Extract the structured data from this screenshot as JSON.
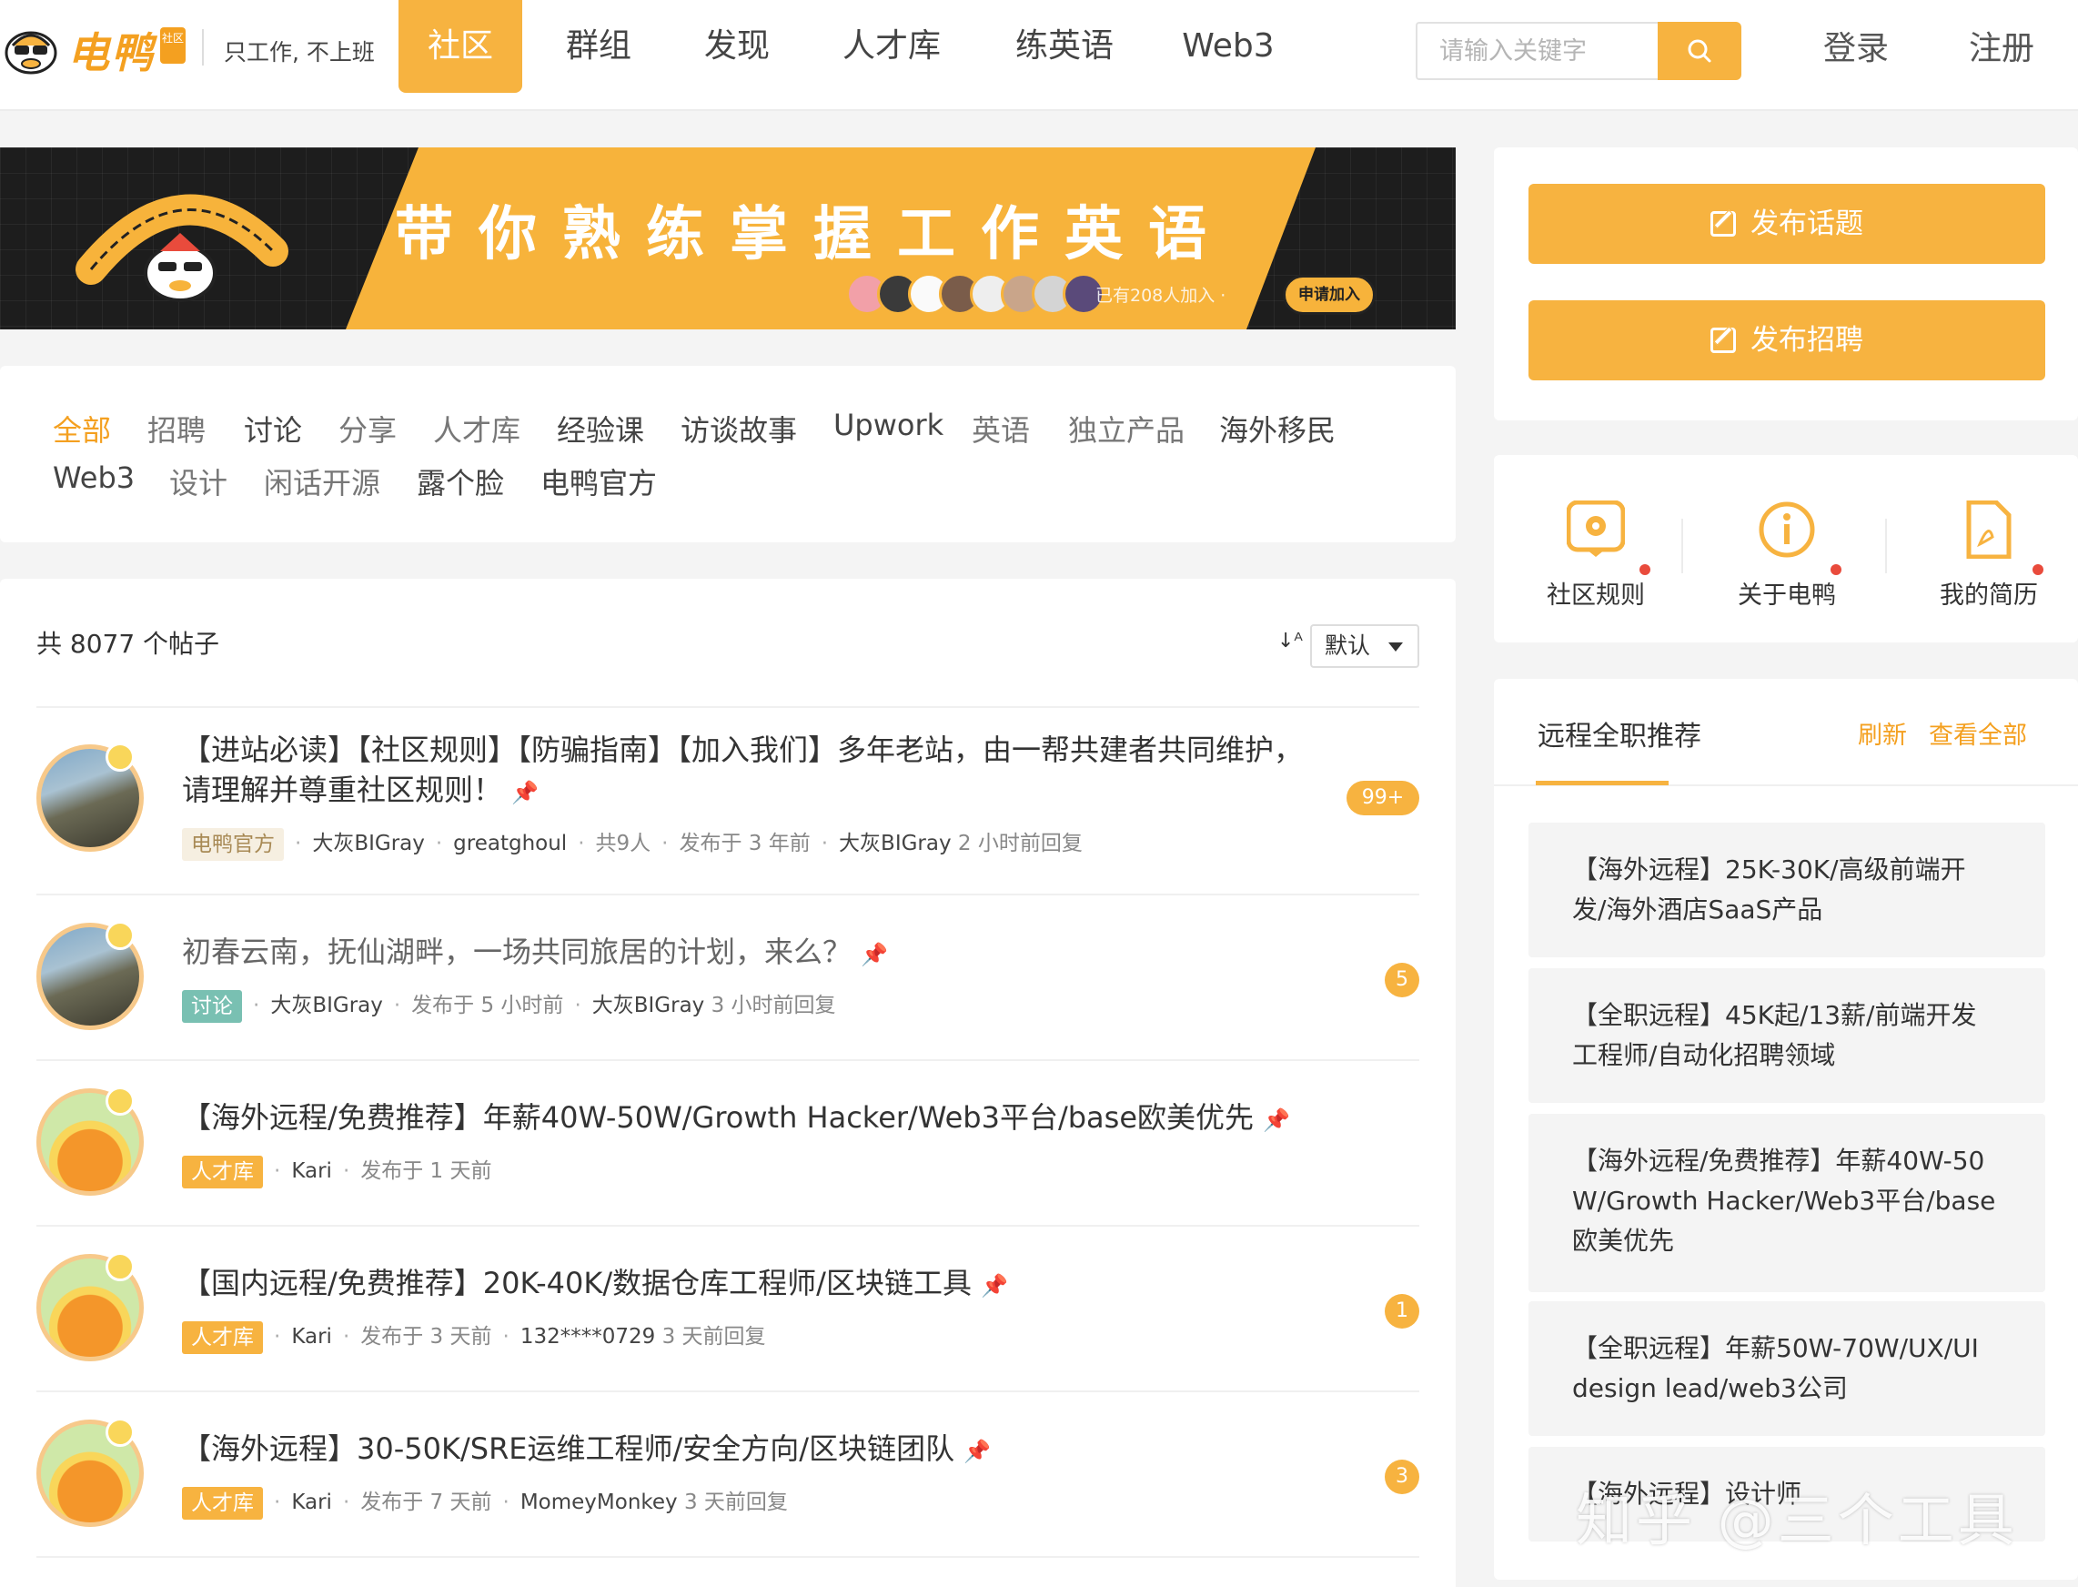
{
  "header": {
    "brand": "电鸭",
    "brand_tag": "社区",
    "slogan": "只工作, 不上班",
    "nav": [
      "社区",
      "群组",
      "发现",
      "人才库",
      "练英语",
      "Web3"
    ],
    "search_placeholder": "请输入关键字",
    "login": "登录",
    "register": "注册",
    "accent_color": "#f7b340"
  },
  "banner": {
    "title": "带你熟练掌握工作英语",
    "joined": "已有208人加入 ·",
    "apply": "申请加入"
  },
  "categories": {
    "row1": [
      "全部",
      "招聘",
      "讨论",
      "分享",
      "人才库",
      "经验课",
      "访谈故事",
      "Upwork",
      "英语",
      "独立产品",
      "海外移民"
    ],
    "row2": [
      "Web3",
      "设计",
      "闲话开源",
      "露个脸",
      "电鸭官方"
    ],
    "active": "全部"
  },
  "posts": {
    "count_text": "共 8077 个帖子",
    "sort_label": "默认",
    "items": [
      {
        "title_line1": "【进站必读】【社区规则】【防骗指南】【加入我们】多年老站，由一帮共建者共同维护，",
        "title_line2": "请理解并尊重社区规则！",
        "tag": "电鸭官方",
        "author": "大灰BIGray",
        "coauthor": "greatghoul",
        "people": "共9人",
        "posted": "发布于 3 年前",
        "replier": "大灰BIGray",
        "replied": "2 小时前回复",
        "count": "99+"
      },
      {
        "title_line1": "初春云南，抚仙湖畔，一场共同旅居的计划，来么？",
        "tag": "讨论",
        "author": "大灰BIGray",
        "posted": "发布于 5 小时前",
        "replier": "大灰BIGray",
        "replied": "3 小时前回复",
        "count": "5"
      },
      {
        "title_line1": "【海外远程/免费推荐】年薪40W-50W/Growth Hacker/Web3平台/base欧美优先",
        "tag": "人才库",
        "author": "Kari",
        "posted": "发布于 1 天前"
      },
      {
        "title_line1": "【国内远程/免费推荐】20K-40K/数据仓库工程师/区块链工具",
        "tag": "人才库",
        "author": "Kari",
        "posted": "发布于 3 天前",
        "replier": "132****0729",
        "replied": "3 天前回复",
        "count": "1"
      },
      {
        "title_line1": "【海外远程】30-50K/SRE运维工程师/安全方向/区块链团队",
        "tag": "人才库",
        "author": "Kari",
        "posted": "发布于 7 天前",
        "replier": "MomeyMonkey",
        "replied": "3 天前回复",
        "count": "3"
      }
    ]
  },
  "sidebar": {
    "publish_topic": "发布话题",
    "publish_job": "发布招聘",
    "quick_links": [
      "社区规则",
      "关于电鸭",
      "我的简历"
    ],
    "jobs_title": "远程全职推荐",
    "refresh": "刷新",
    "view_all": "查看全部",
    "jobs": [
      [
        "【海外远程】25K-30K/高级前端开",
        "发/海外酒店SaaS产品"
      ],
      [
        "【全职远程】45K起/13薪/前端开发",
        "工程师/自动化招聘领域"
      ],
      [
        "【海外远程/免费推荐】年薪40W-50",
        "W/Growth Hacker/Web3平台/base",
        "欧美优先"
      ],
      [
        "【全职远程】年薪50W-70W/UX/UI",
        "design lead/web3公司"
      ],
      [
        "【海外远程】设计师"
      ]
    ]
  },
  "watermark": "知乎 @三个工具"
}
